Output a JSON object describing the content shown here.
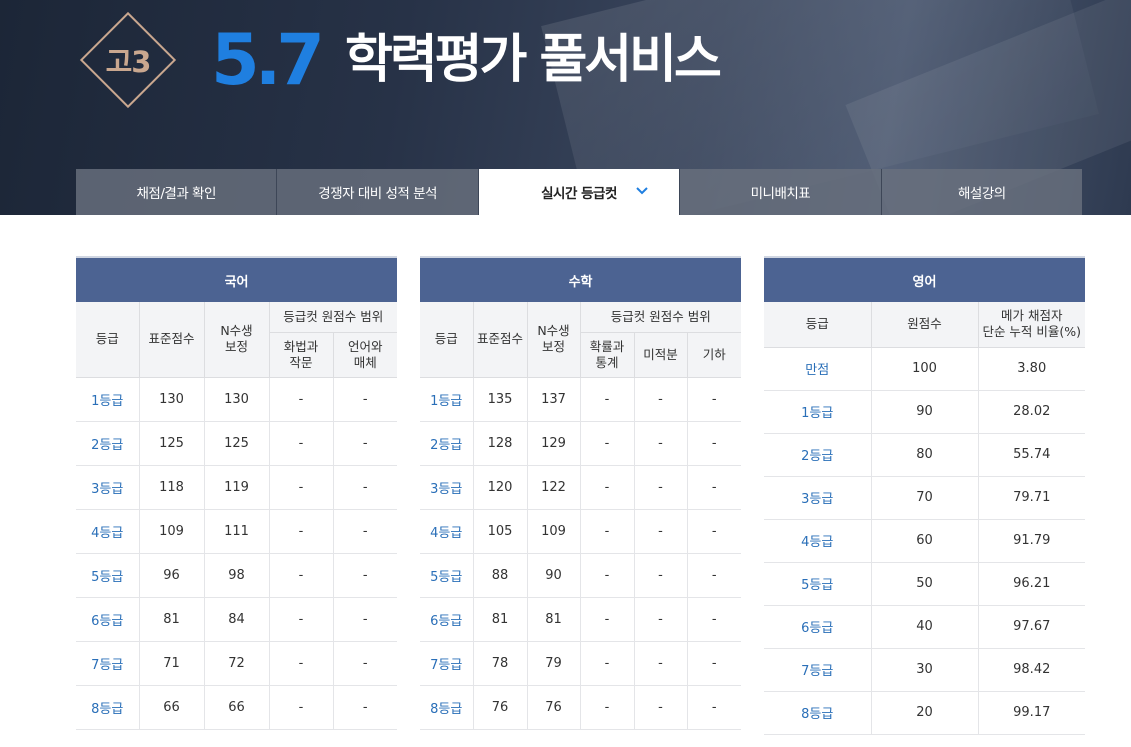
{
  "hero": {
    "badge": "고3",
    "date": "5.7",
    "title": "학력평가 풀서비스"
  },
  "tabs": [
    {
      "label": "채점/결과 확인",
      "active": false
    },
    {
      "label": "경쟁자 대비 성적 분석",
      "active": false
    },
    {
      "label": "실시간 등급컷",
      "active": true
    },
    {
      "label": "미니배치표",
      "active": false
    },
    {
      "label": "해설강의",
      "active": false
    }
  ],
  "korean": {
    "title": "국어",
    "headers": {
      "grade": "등급",
      "std": "표준점수",
      "n_line1": "N수생",
      "n_line2": "보정",
      "range": "등급컷 원점수 범위",
      "sub1_line1": "화법과",
      "sub1_line2": "작문",
      "sub2_line1": "언어와",
      "sub2_line2": "매체"
    },
    "rows": [
      [
        "1등급",
        "130",
        "130",
        "-",
        "-"
      ],
      [
        "2등급",
        "125",
        "125",
        "-",
        "-"
      ],
      [
        "3등급",
        "118",
        "119",
        "-",
        "-"
      ],
      [
        "4등급",
        "109",
        "111",
        "-",
        "-"
      ],
      [
        "5등급",
        "96",
        "98",
        "-",
        "-"
      ],
      [
        "6등급",
        "81",
        "84",
        "-",
        "-"
      ],
      [
        "7등급",
        "71",
        "72",
        "-",
        "-"
      ],
      [
        "8등급",
        "66",
        "66",
        "-",
        "-"
      ]
    ]
  },
  "math": {
    "title": "수학",
    "headers": {
      "grade": "등급",
      "std": "표준점수",
      "n_line1": "N수생",
      "n_line2": "보정",
      "range": "등급컷 원점수 범위",
      "sub1_line1": "확률과",
      "sub1_line2": "통계",
      "sub2": "미적분",
      "sub3": "기하"
    },
    "rows": [
      [
        "1등급",
        "135",
        "137",
        "-",
        "-",
        "-"
      ],
      [
        "2등급",
        "128",
        "129",
        "-",
        "-",
        "-"
      ],
      [
        "3등급",
        "120",
        "122",
        "-",
        "-",
        "-"
      ],
      [
        "4등급",
        "105",
        "109",
        "-",
        "-",
        "-"
      ],
      [
        "5등급",
        "88",
        "90",
        "-",
        "-",
        "-"
      ],
      [
        "6등급",
        "81",
        "81",
        "-",
        "-",
        "-"
      ],
      [
        "7등급",
        "78",
        "79",
        "-",
        "-",
        "-"
      ],
      [
        "8등급",
        "76",
        "76",
        "-",
        "-",
        "-"
      ]
    ]
  },
  "english": {
    "title": "영어",
    "headers": {
      "grade": "등급",
      "raw": "원점수",
      "ratio_line1": "메가 채점자",
      "ratio_line2": "단순 누적 비율(%)"
    },
    "rows": [
      [
        "만점",
        "100",
        "3.80"
      ],
      [
        "1등급",
        "90",
        "28.02"
      ],
      [
        "2등급",
        "80",
        "55.74"
      ],
      [
        "3등급",
        "70",
        "79.71"
      ],
      [
        "4등급",
        "60",
        "91.79"
      ],
      [
        "5등급",
        "50",
        "96.21"
      ],
      [
        "6등급",
        "40",
        "97.67"
      ],
      [
        "7등급",
        "30",
        "98.42"
      ],
      [
        "8등급",
        "20",
        "99.17"
      ]
    ]
  }
}
